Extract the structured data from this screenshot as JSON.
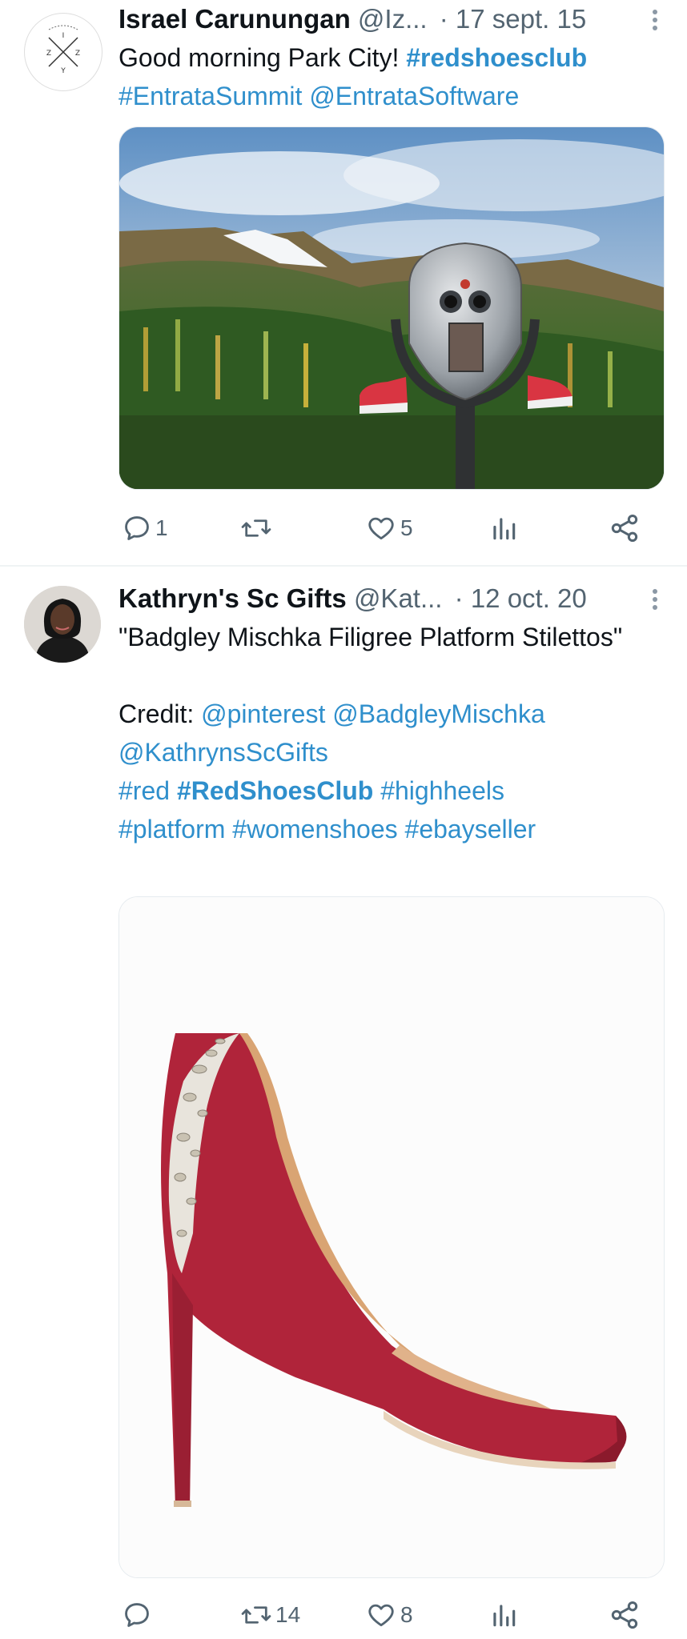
{
  "tweets": [
    {
      "author_name": "Israel Carunungan",
      "handle": "@Iz...",
      "date": "· 17 sept. 15",
      "text": [
        {
          "t": "Good morning Park City! ",
          "kind": "plain"
        },
        {
          "t": "#redshoesclub",
          "kind": "tag-bold"
        },
        {
          "t": "\n",
          "kind": "plain"
        },
        {
          "t": "#EntrataSummit",
          "kind": "tag"
        },
        {
          "t": " ",
          "kind": "plain"
        },
        {
          "t": "@EntrataSoftware",
          "kind": "tag"
        }
      ],
      "avatar_icon": "lettered-compass-logo",
      "image_icon": "mountain-binocular-viewer-red-shoes-photo",
      "actions": {
        "reply": "1",
        "retweet": "",
        "like": "5",
        "views": ""
      }
    },
    {
      "author_name": "Kathryn's Sc Gifts",
      "handle": "@Kat...",
      "date": "· 12 oct. 20",
      "text": [
        {
          "t": "\"Badgley Mischka Filigree Platform Stilettos\"\n\nCredit: ",
          "kind": "plain"
        },
        {
          "t": "@pinterest",
          "kind": "tag"
        },
        {
          "t": " ",
          "kind": "plain"
        },
        {
          "t": "@BadgleyMischka",
          "kind": "tag"
        },
        {
          "t": "\n",
          "kind": "plain"
        },
        {
          "t": "@KathrynsScGifts",
          "kind": "tag"
        },
        {
          "t": "\n",
          "kind": "plain"
        },
        {
          "t": "#red",
          "kind": "tag"
        },
        {
          "t": " ",
          "kind": "plain"
        },
        {
          "t": "#RedShoesClub",
          "kind": "tag-bold"
        },
        {
          "t": " ",
          "kind": "plain"
        },
        {
          "t": "#highheels",
          "kind": "tag"
        },
        {
          "t": "\n",
          "kind": "plain"
        },
        {
          "t": "#platform",
          "kind": "tag"
        },
        {
          "t": " ",
          "kind": "plain"
        },
        {
          "t": "#womenshoes",
          "kind": "tag"
        },
        {
          "t": " ",
          "kind": "plain"
        },
        {
          "t": "#ebayseller",
          "kind": "tag"
        }
      ],
      "avatar_icon": "profile-photo",
      "image_icon": "red-stiletto-shoe-photo",
      "actions": {
        "reply": "",
        "retweet": "14",
        "like": "8",
        "views": ""
      }
    }
  ],
  "colors": {
    "link": "#2f8fcc",
    "text": "#0f1419",
    "secondary": "#536471",
    "divider": "#eff3f4"
  }
}
